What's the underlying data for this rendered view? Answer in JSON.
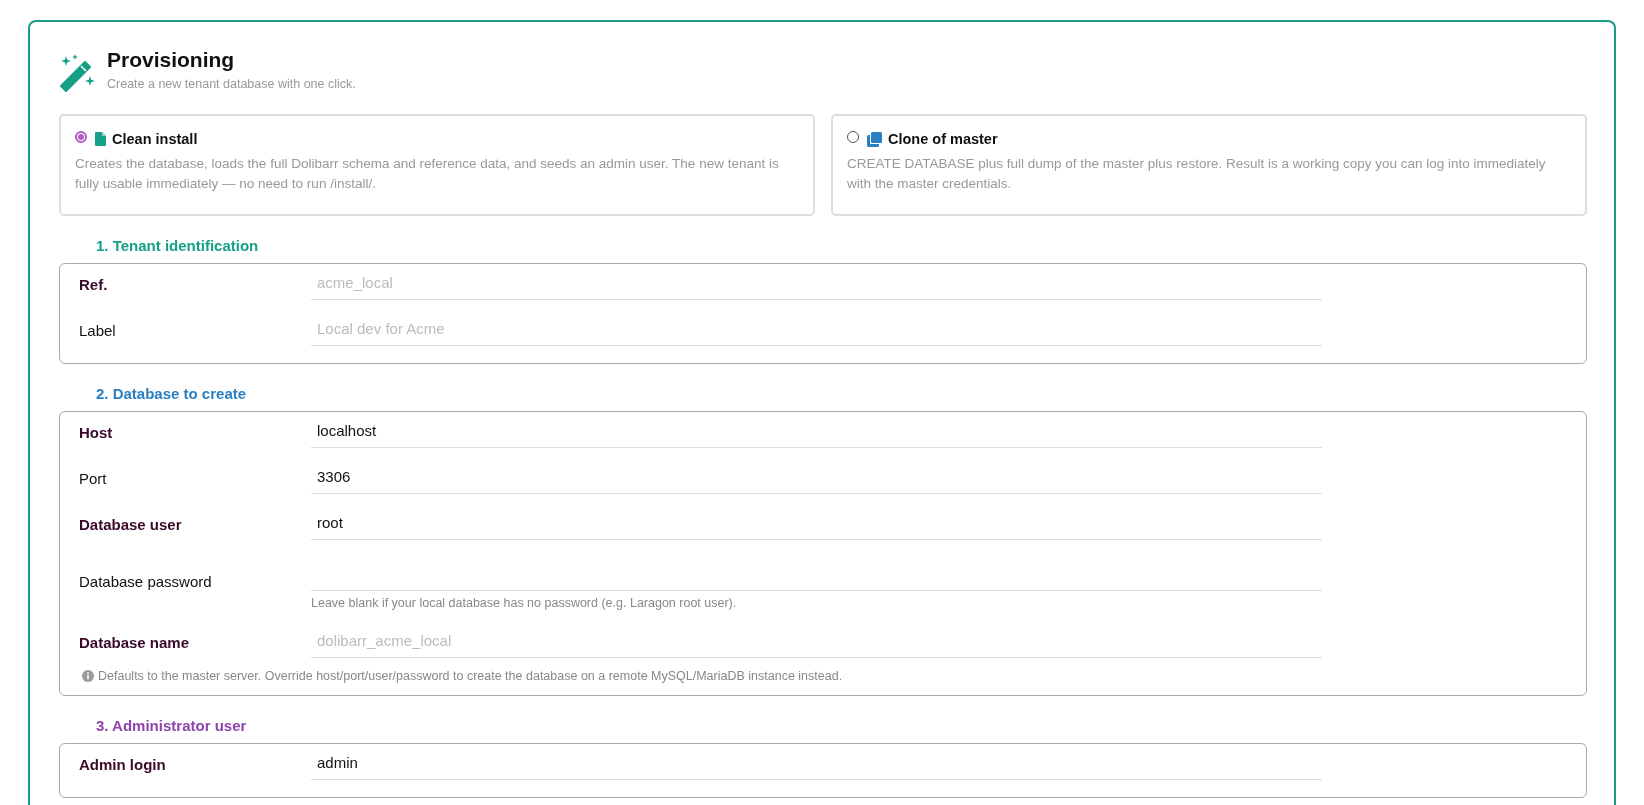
{
  "header": {
    "title": "Provisioning",
    "subtitle": "Create a new tenant database with one click."
  },
  "modes": [
    {
      "title": "Clean install",
      "description": "Creates the database, loads the full Dolibarr schema and reference data, and seeds an admin user. The new tenant is fully usable immediately — no need to run /install/.",
      "selected": true
    },
    {
      "title": "Clone of master",
      "description": "CREATE DATABASE plus full dump of the master plus restore. Result is a working copy you can log into immediately with the master credentials.",
      "selected": false
    }
  ],
  "sections": [
    {
      "legend": "1. Tenant identification",
      "color": "#16a085",
      "fields": [
        {
          "label": "Ref.",
          "required": true,
          "placeholder": "acme_local"
        },
        {
          "label": "Label",
          "required": false,
          "placeholder": "Local dev for Acme"
        }
      ]
    },
    {
      "legend": "2. Database to create",
      "color": "#2a7fc1",
      "fields": [
        {
          "label": "Host",
          "required": true,
          "value": "localhost"
        },
        {
          "label": "Port",
          "required": false,
          "value": "3306"
        },
        {
          "label": "Database user",
          "required": true,
          "value": "root"
        },
        {
          "label": "Database password",
          "required": false,
          "help": "Leave blank if your local database has no password (e.g. Laragon root user)."
        },
        {
          "label": "Database name",
          "required": true,
          "placeholder": "dolibarr_acme_local"
        }
      ],
      "note": "Defaults to the master server. Override host/port/user/password to create the database on a remote MySQL/MariaDB instance instead."
    },
    {
      "legend": "3. Administrator user",
      "color": "#8e44ad",
      "fields": [
        {
          "label": "Admin login",
          "required": true,
          "value": "admin"
        }
      ]
    }
  ]
}
